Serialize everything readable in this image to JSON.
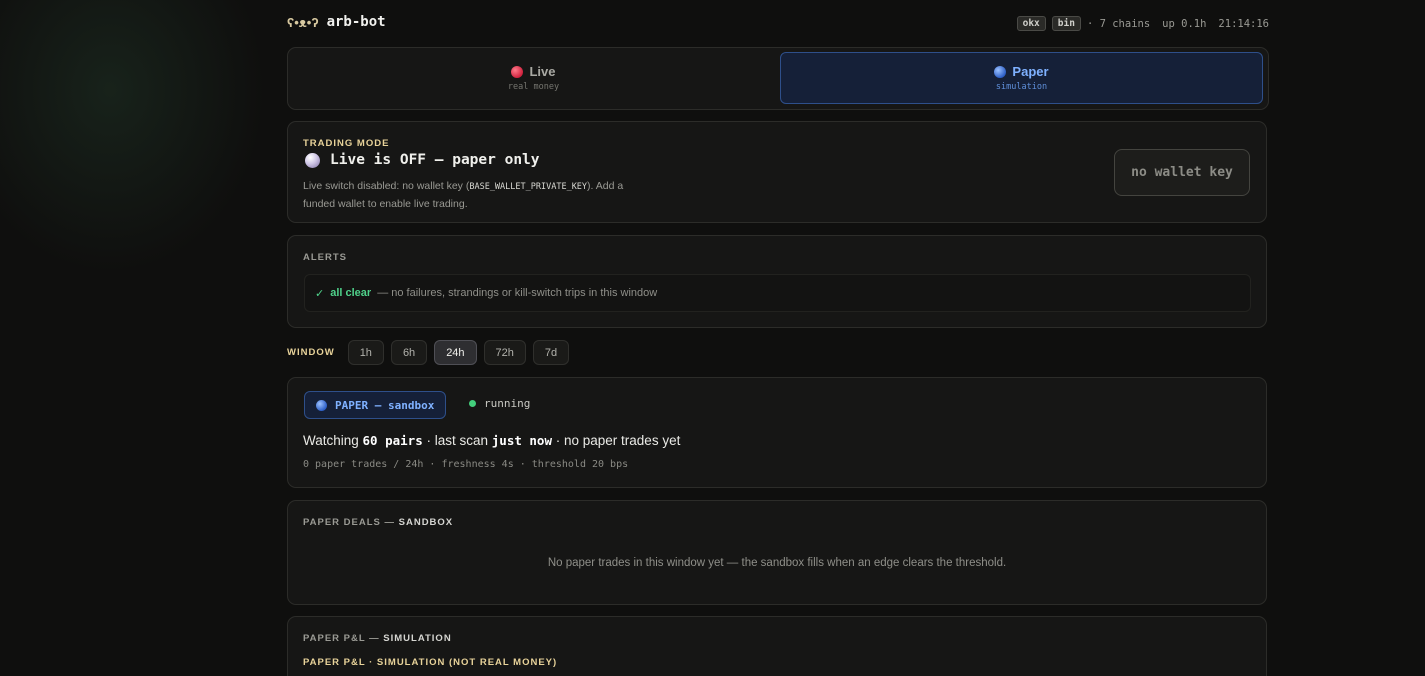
{
  "header": {
    "logo_icon": "bear-icon",
    "title": "arb-bot",
    "chips": [
      "okx",
      "bin"
    ],
    "chains": "· 7 chains",
    "uptime": "up 0.1h",
    "clock": "21:14:16"
  },
  "mode_toggle": {
    "live": {
      "label": "Live",
      "sub": "real money",
      "icon": "red-dot-icon",
      "active": false
    },
    "paper": {
      "label": "Paper",
      "sub": "simulation",
      "icon": "blue-dot-icon",
      "active": true
    }
  },
  "trading_mode": {
    "label": "TRADING MODE",
    "heading": "Live is OFF — paper only",
    "desc_pre": "Live switch disabled: no wallet key (",
    "desc_code": "BASE_WALLET_PRIVATE_KEY",
    "desc_post": "). Add a funded wallet to enable live trading.",
    "button": "no wallet key"
  },
  "alerts": {
    "label": "ALERTS",
    "check": "✓",
    "status": "all clear",
    "detail": "— no failures, strandings or kill-switch trips in this window"
  },
  "window": {
    "label": "WINDOW",
    "options": [
      "1h",
      "6h",
      "24h",
      "72h",
      "7d"
    ],
    "selected": "24h"
  },
  "status": {
    "badge": "PAPER — sandbox",
    "state": "running",
    "line_pre": "Watching ",
    "pairs": "60 pairs",
    "line_mid": " · last scan ",
    "scan": "just now",
    "line_post": " · no paper trades yet",
    "sub": "0 paper trades / 24h · freshness 4s · threshold 20 bps"
  },
  "paper_deals": {
    "label_pre": "PAPER DEALS — ",
    "label_bold": "SANDBOX",
    "empty": "No paper trades in this window yet — the sandbox fills when an edge clears the threshold."
  },
  "pnl": {
    "label_pre": "PAPER P&L — ",
    "label_bold": "SIMULATION",
    "sub_label": "PAPER P&L · SIMULATION (NOT REAL MONEY)"
  },
  "colors": {
    "accent_blue": "#7fb1ff",
    "accent_gold": "#e8d39a",
    "ok_green": "#4fd18a",
    "live_red": "#d0223e"
  }
}
